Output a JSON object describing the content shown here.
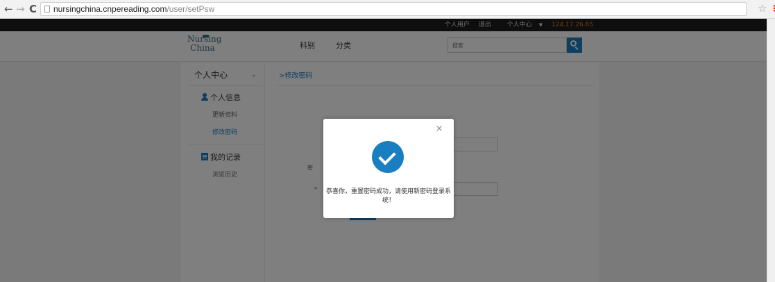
{
  "browser": {
    "url_host": "nursingchina.cnpereading.com",
    "url_path": "/user/setPsw"
  },
  "topbar": {
    "personal_user": "个人用户",
    "logout": "退出",
    "personal_center": "个人中心",
    "ip": "124.17.26.65"
  },
  "header": {
    "logo_line1": "Nursing",
    "logo_line2": "China",
    "nav": [
      "科别",
      "分类"
    ],
    "search_placeholder": "搜索"
  },
  "sidebar": {
    "title": "个人中心",
    "sections": [
      {
        "label": "个人信息",
        "icon": "user-icon",
        "links": [
          "更新资料",
          "修改密码"
        ]
      },
      {
        "label": "我的记录",
        "icon": "record-icon",
        "links": [
          "浏览历史"
        ]
      }
    ]
  },
  "main": {
    "breadcrumb": "修改密码"
  },
  "modal": {
    "message": "恭喜你，重置密码成功，请使用新密码登录系统！",
    "icon": "check-circle-icon"
  },
  "colors": {
    "accent": "#1a7fc0",
    "topbar_bg": "#1c1c1c",
    "ip_text": "#e07a2a"
  }
}
